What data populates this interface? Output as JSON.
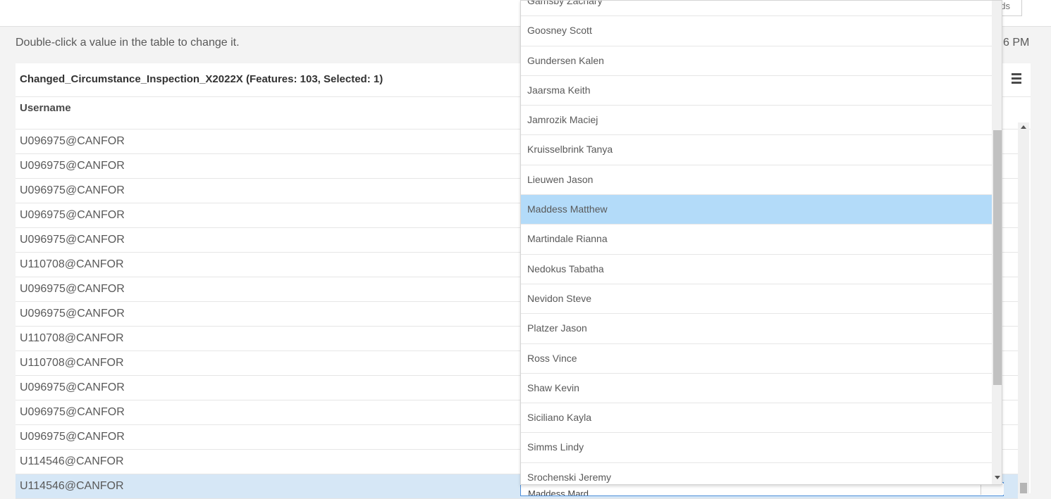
{
  "topbar": {
    "button_label": "ds"
  },
  "instructions": "Double-click a value in the table to change it.",
  "timestamp": "6 PM",
  "table": {
    "title": "Changed_Circumstance_Inspection_X2022X (Features: 103, Selected: 1)",
    "column": "Username",
    "rows": [
      "U096975@CANFOR",
      "U096975@CANFOR",
      "U096975@CANFOR",
      "U096975@CANFOR",
      "U096975@CANFOR",
      "U110708@CANFOR",
      "U096975@CANFOR",
      "U096975@CANFOR",
      "U110708@CANFOR",
      "U110708@CANFOR",
      "U096975@CANFOR",
      "U096975@CANFOR",
      "U096975@CANFOR",
      "U114546@CANFOR",
      "U114546@CANFOR"
    ],
    "selected_row_index": 14
  },
  "dropdown": {
    "current_value": "Maddess Mard",
    "options": [
      "Gamsby Zachary",
      "Goosney Scott",
      "Gundersen Kalen",
      "Jaarsma Keith",
      "Jamrozik Maciej",
      "Kruisselbrink Tanya",
      "Lieuwen Jason",
      "Maddess Matthew",
      "Martindale Rianna",
      "Nedokus Tabatha",
      "Nevidon Steve",
      "Platzer Jason",
      "Ross Vince",
      "Shaw Kevin",
      "Siciliano Kayla",
      "Simms Lindy",
      "Srochenski Jeremy"
    ],
    "highlighted_index": 7
  },
  "icons": {
    "menu": "hamburger-menu-icon",
    "scroll_up": "scroll-up-arrow-icon",
    "scroll_down": "scroll-down-arrow-icon"
  },
  "colors": {
    "selected_row": "#d6e7f6",
    "highlighted_option": "#b3dbf9",
    "editor_border": "#4c8ed9"
  }
}
